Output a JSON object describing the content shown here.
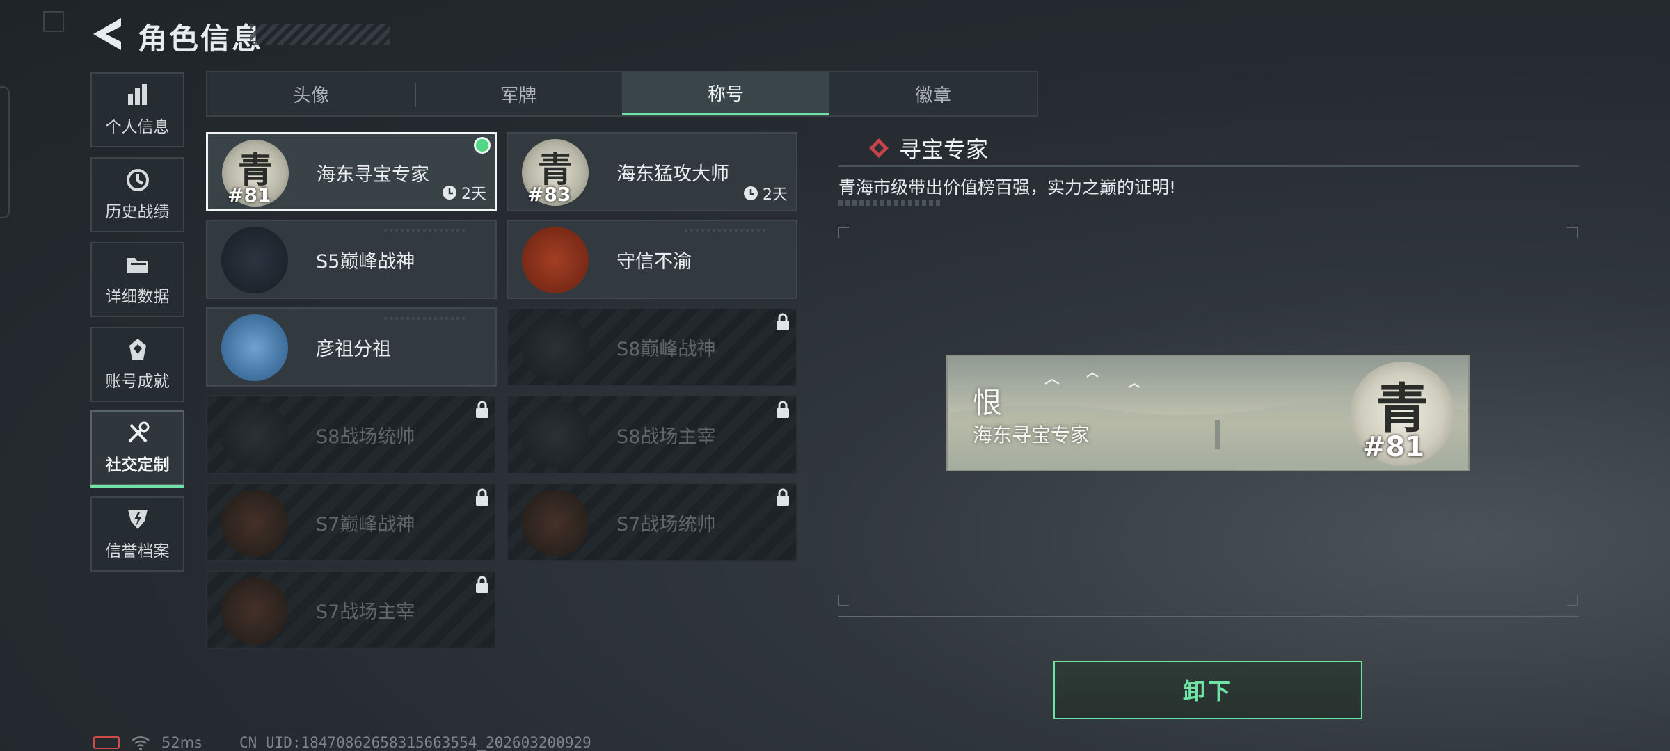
{
  "page": {
    "title": "角色信息"
  },
  "sidebar": {
    "items": [
      {
        "label": "个人信息",
        "icon": "bar-chart-icon"
      },
      {
        "label": "历史战绩",
        "icon": "history-clock-icon"
      },
      {
        "label": "详细数据",
        "icon": "folder-icon"
      },
      {
        "label": "账号成就",
        "icon": "achievement-icon"
      },
      {
        "label": "社交定制",
        "icon": "tools-icon",
        "active": true
      },
      {
        "label": "信誉档案",
        "icon": "credit-shield-icon"
      }
    ]
  },
  "tabs": [
    {
      "label": "头像"
    },
    {
      "label": "军牌"
    },
    {
      "label": "称号",
      "active": true
    },
    {
      "label": "徽章"
    }
  ],
  "titles": [
    {
      "name": "海东寻宝专家",
      "emblem_char": "青",
      "emblem_num": "81",
      "duration": "2天",
      "selected": true,
      "equipped": true,
      "locked": false
    },
    {
      "name": "海东猛攻大师",
      "emblem_char": "青",
      "emblem_num": "83",
      "duration": "2天",
      "selected": false,
      "locked": false
    },
    {
      "name": "S5巅峰战神",
      "locked": false
    },
    {
      "name": "守信不渝",
      "locked": false
    },
    {
      "name": "彦祖分祖",
      "locked": false
    },
    {
      "name": "S8巅峰战神",
      "locked": true
    },
    {
      "name": "S8战场统帅",
      "locked": true
    },
    {
      "name": "S8战场主宰",
      "locked": true
    },
    {
      "name": "S7巅峰战神",
      "locked": true
    },
    {
      "name": "S7战场统帅",
      "locked": true
    },
    {
      "name": "S7战场主宰",
      "locked": true
    }
  ],
  "detail": {
    "title": "寻宝专家",
    "description": "青海市级带出价值榜百强，实力之巅的证明!",
    "preview": {
      "player_name": "恨",
      "title": "海东寻宝专家",
      "emblem_char": "青",
      "emblem_num": "81"
    },
    "action_label": "卸下"
  },
  "status_bar": {
    "ping": "52ms",
    "uid": "CN UID:18470862658315663554_202603200929"
  },
  "colors": {
    "accent": "#6fe3a4",
    "battery_low": "#d04a4a"
  }
}
